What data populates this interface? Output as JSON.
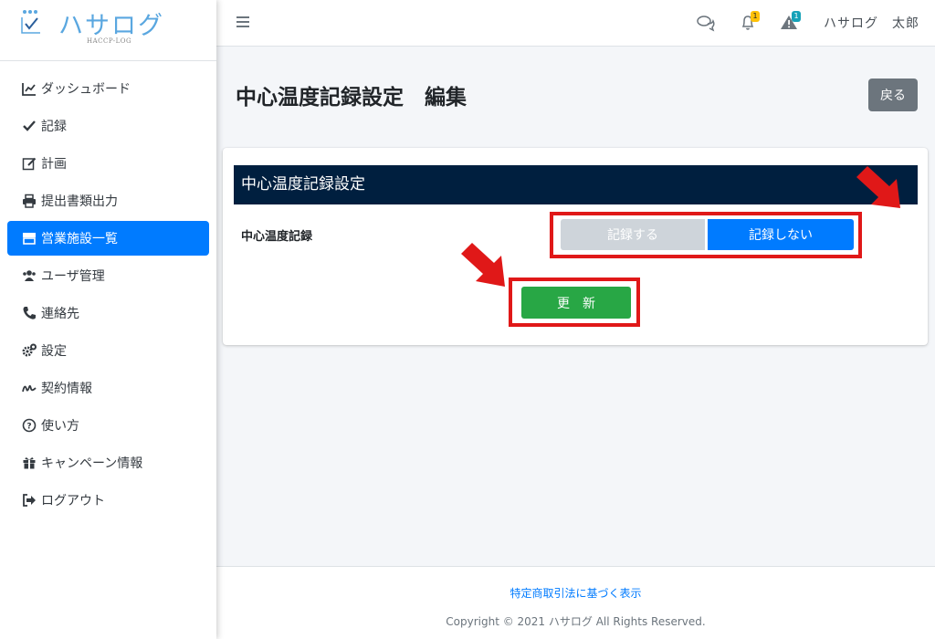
{
  "brand": {
    "name": "ハサログ",
    "sub": "HACCP-LOG"
  },
  "sidebar": {
    "items": [
      {
        "label": "ダッシュボード",
        "icon": "chart-line-icon"
      },
      {
        "label": "記録",
        "icon": "check-icon"
      },
      {
        "label": "計画",
        "icon": "edit-icon"
      },
      {
        "label": "提出書類出力",
        "icon": "printer-icon"
      },
      {
        "label": "営業施設一覧",
        "icon": "store-icon",
        "active": true
      },
      {
        "label": "ユーザ管理",
        "icon": "users-icon"
      },
      {
        "label": "連絡先",
        "icon": "phone-icon"
      },
      {
        "label": "設定",
        "icon": "gears-icon"
      },
      {
        "label": "契約情報",
        "icon": "signature-icon"
      },
      {
        "label": "使い方",
        "icon": "question-circle-icon"
      },
      {
        "label": "キャンペーン情報",
        "icon": "gift-icon"
      },
      {
        "label": "ログアウト",
        "icon": "sign-out-icon"
      }
    ]
  },
  "header": {
    "notifications_count": "1",
    "alerts_count": "1",
    "user_name": "ハサログ　太郎"
  },
  "page": {
    "title": "中心温度記録設定　編集",
    "back_label": "戻る"
  },
  "card": {
    "header": "中心温度記録設定",
    "field_label": "中心温度記録",
    "option_record": "記録する",
    "option_no_record": "記録しない",
    "selected": "記録しない",
    "update_label": "更　新"
  },
  "footer": {
    "link": "特定商取引法に基づく表示",
    "copyright": "Copyright © 2021 ハサログ All Rights Reserved."
  },
  "colors": {
    "primary": "#007bff",
    "success": "#28a745",
    "card_header": "#001f3f",
    "highlight": "#e01818"
  }
}
